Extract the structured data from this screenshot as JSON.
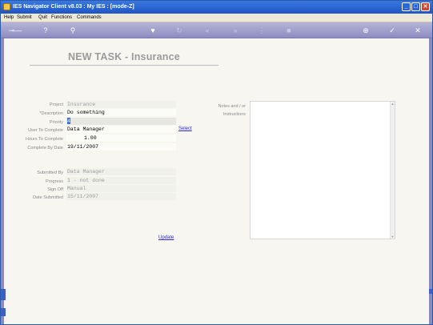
{
  "window": {
    "title": "IES Navigator Client v8.03 : My IES :       [mode-Z]",
    "minimize": "_",
    "maximize": "□",
    "close": "✕"
  },
  "menu": {
    "items": [
      "Help",
      "Submit",
      "Quit",
      "Functions",
      "Commands"
    ]
  },
  "toolbar": {
    "icons": [
      "key-icon",
      "help-icon",
      "search-icon",
      "heart-icon",
      "refresh-icon",
      "rewind-icon",
      "fast-forward-icon",
      "tree-icon",
      "stop-icon",
      "navigate-icon",
      "ok-icon",
      "close-icon"
    ]
  },
  "page": {
    "heading": "NEW TASK - Insurance"
  },
  "form": {
    "project_label": "Project",
    "project_value": "Insurance",
    "description_label": "*Description",
    "description_value": "Do something",
    "priority_label": "Priority",
    "priority_value": "4",
    "user_label": "User To Complete",
    "user_value": "Data Manager",
    "select_link": "Select",
    "hours_label": "Hours To Complete",
    "hours_value": "1.00",
    "complete_by_label": "Complete By Date",
    "complete_by_value": "19/11/2007",
    "notes_label_1": "Notes and / or",
    "notes_label_2": "Instructions",
    "notes_value": ""
  },
  "submission": {
    "submitted_by_label": "Submitted By",
    "submitted_by_value": "Data Manager",
    "progress_label": "Progress",
    "progress_value": "1 - not done",
    "sign_off_label": "Sign Off",
    "sign_off_value": "Manual",
    "date_submitted_label": "Date Submitted",
    "date_submitted_value": "15/11/2007"
  },
  "actions": {
    "update_link": "Update"
  }
}
